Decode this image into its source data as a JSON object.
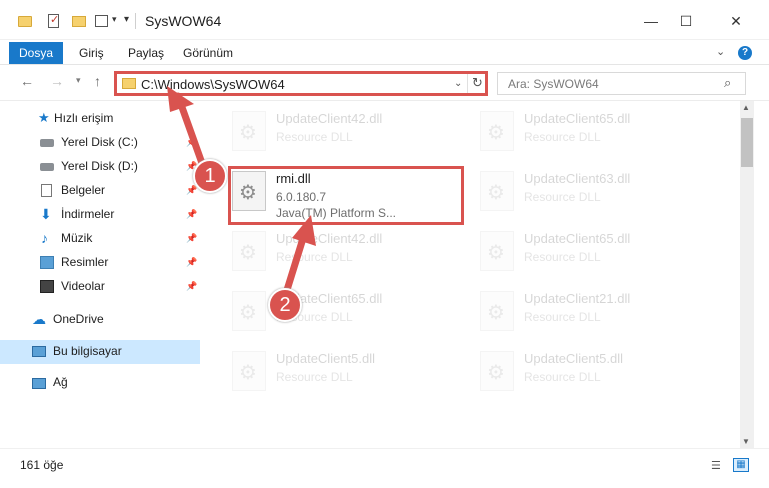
{
  "window": {
    "title": "SysWOW64",
    "minimize_glyph": "—",
    "maximize_glyph": "☐",
    "close_glyph": "✕"
  },
  "ribbon": {
    "tabs": [
      {
        "label": "Dosya",
        "active": true
      },
      {
        "label": "Giriş"
      },
      {
        "label": "Paylaş"
      },
      {
        "label": "Görünüm"
      }
    ],
    "help_glyph": "?"
  },
  "address": {
    "path": "C:\\Windows\\SysWOW64",
    "search_placeholder": "Ara: SysWOW64"
  },
  "sidebar": {
    "items": [
      {
        "label": "Hızlı erişim",
        "icon": "star-icon"
      },
      {
        "label": "Yerel Disk (C:)",
        "icon": "disk-icon",
        "pinned": true
      },
      {
        "label": "Yerel Disk (D:)",
        "icon": "disk-icon",
        "pinned": true
      },
      {
        "label": "Belgeler",
        "icon": "document-icon",
        "pinned": true
      },
      {
        "label": "İndirmeler",
        "icon": "download-icon",
        "pinned": true
      },
      {
        "label": "Müzik",
        "icon": "music-icon",
        "pinned": true
      },
      {
        "label": "Resimler",
        "icon": "pictures-icon",
        "pinned": true
      },
      {
        "label": "Videolar",
        "icon": "video-icon",
        "pinned": true
      },
      {
        "label": "OneDrive",
        "icon": "cloud-icon"
      },
      {
        "label": "Bu bilgisayar",
        "icon": "computer-icon",
        "selected": true
      },
      {
        "label": "Ağ",
        "icon": "network-icon"
      }
    ]
  },
  "files": [
    {
      "name": "UpdateClient42.dll",
      "type": "Resource DLL",
      "faded": true
    },
    {
      "name": "UpdateClient65.dll",
      "type": "Resource DLL",
      "faded": true
    },
    {
      "name": "rmi.dll",
      "version": "6.0.180.7",
      "description": "Java(TM) Platform S...",
      "faded": false
    },
    {
      "name": "UpdateClient63.dll",
      "type": "Resource DLL",
      "faded": true
    },
    {
      "name": "UpdateClient42.dll",
      "type": "Resource DLL",
      "faded": true
    },
    {
      "name": "UpdateClient65.dll",
      "type": "Resource DLL",
      "faded": true
    },
    {
      "name": "UpdateClient65.dll",
      "type": "Resource DLL",
      "faded": true
    },
    {
      "name": "UpdateClient21.dll",
      "type": "Resource DLL",
      "faded": true
    },
    {
      "name": "UpdateClient5.dll",
      "type": "Resource DLL",
      "faded": true
    },
    {
      "name": "UpdateClient5.dll",
      "type": "Resource DLL",
      "faded": true
    }
  ],
  "status": {
    "item_count": "161 öğe"
  },
  "annotations": {
    "step1": "1",
    "step2": "2",
    "color": "#d9534f"
  },
  "colors": {
    "accent": "#1979ca",
    "highlight": "#d9534f",
    "selected_bg": "#cce8ff"
  }
}
